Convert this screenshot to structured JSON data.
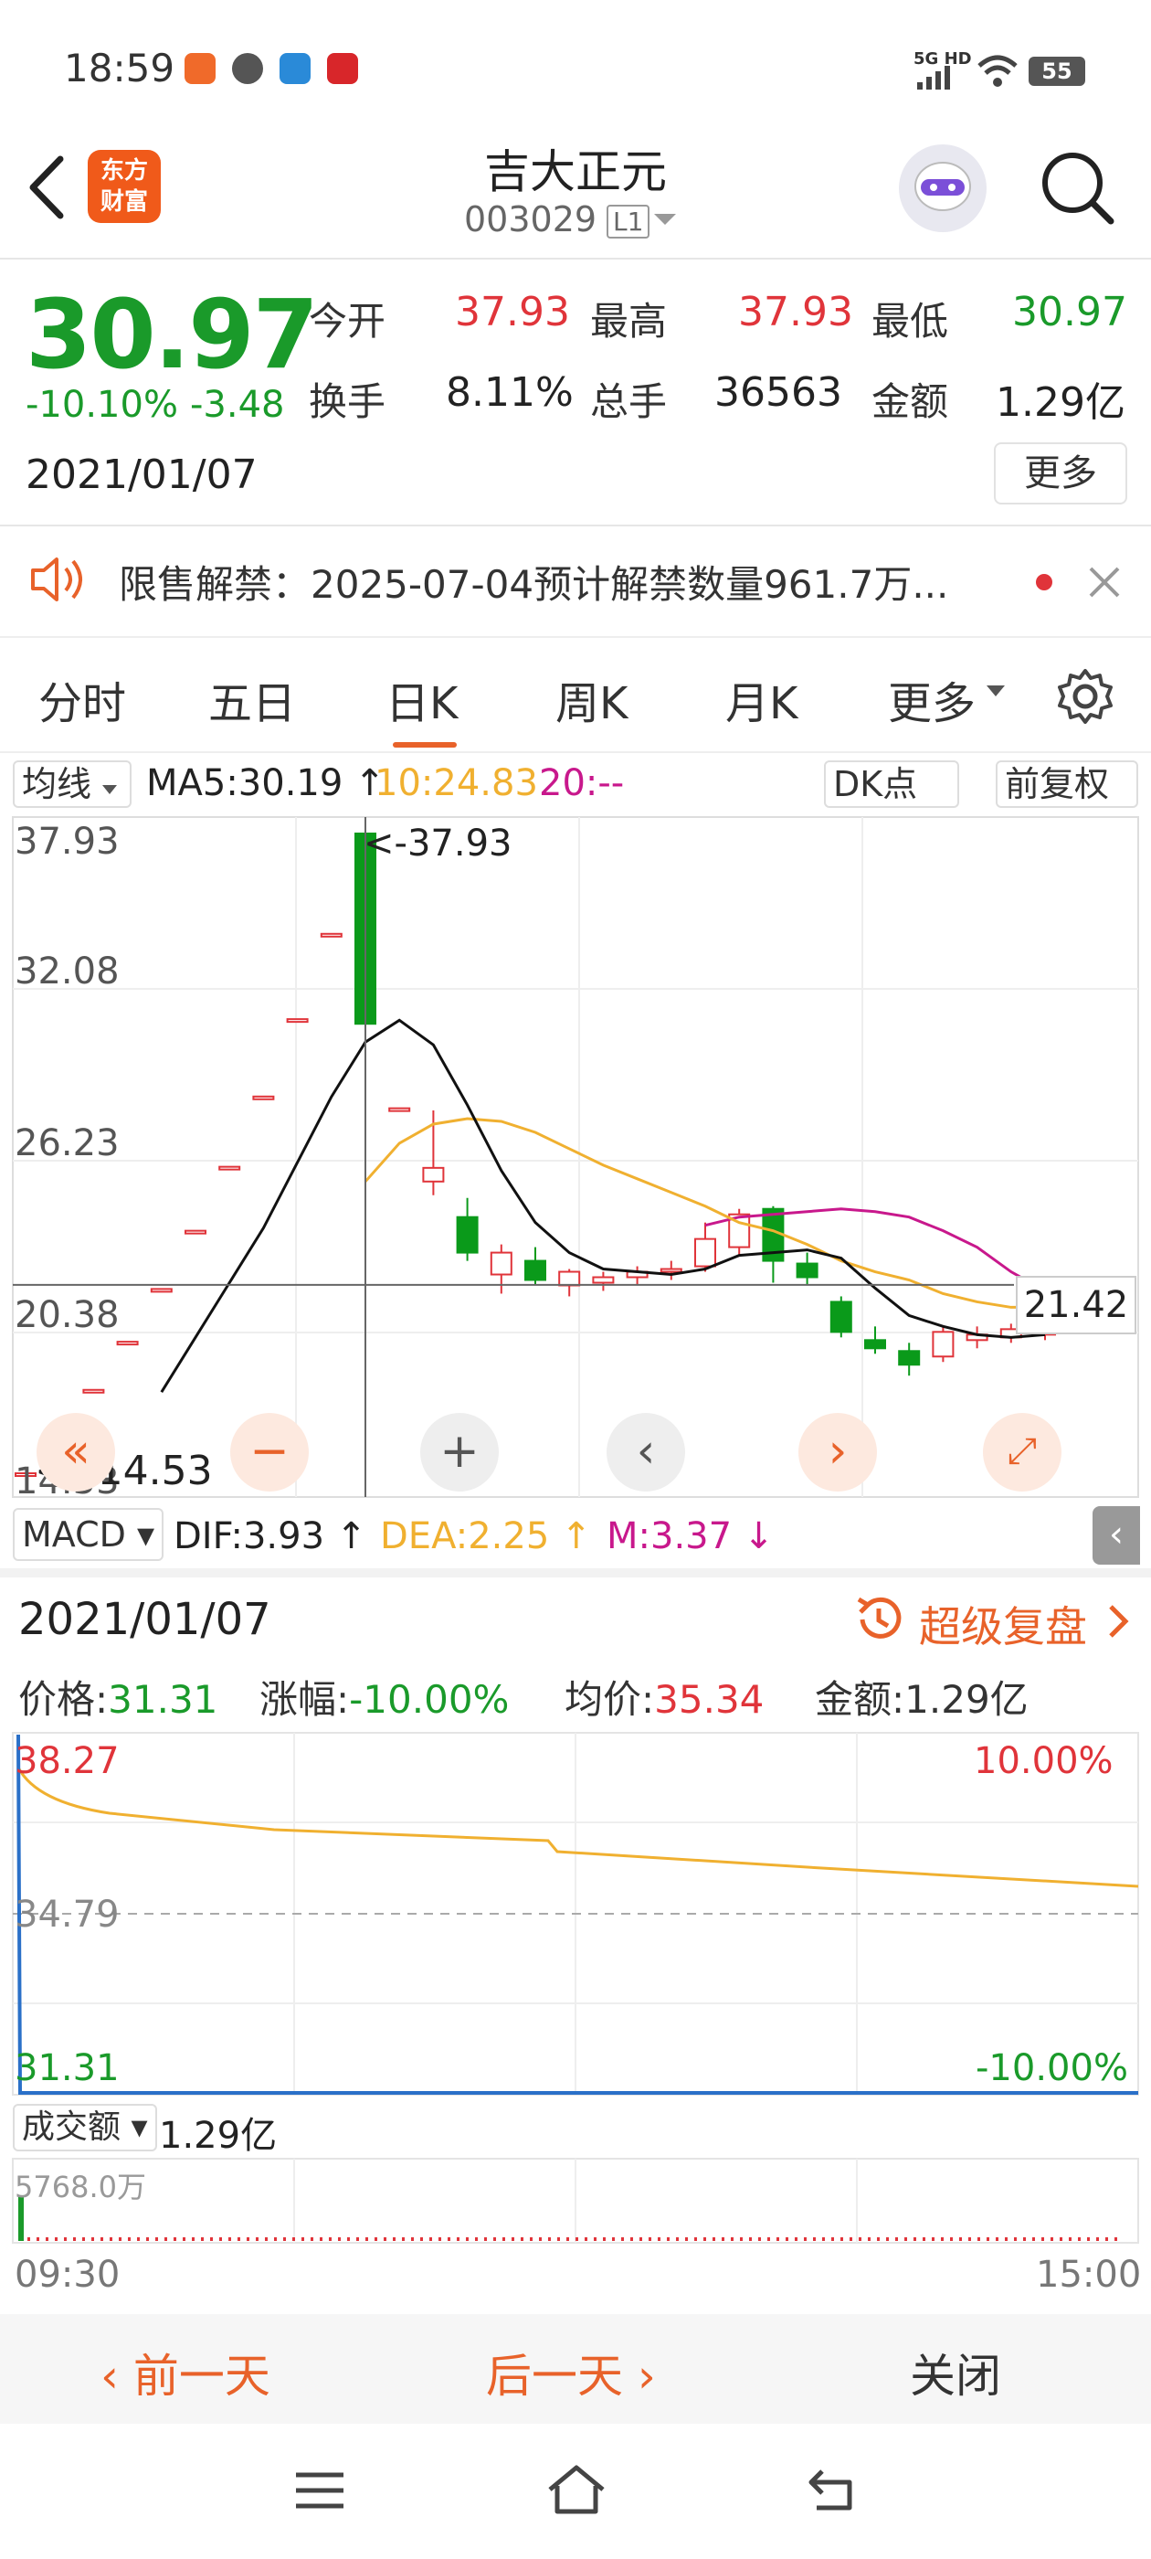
{
  "status_bar": {
    "time": "18:59",
    "network": "5G HD",
    "battery": "55"
  },
  "header": {
    "title": "吉大正元",
    "code": "003029",
    "level": "L1",
    "logo_text": [
      "东方",
      "财富"
    ]
  },
  "quote": {
    "price": "30.97",
    "change_pct": "-10.10%",
    "change": "-3.48",
    "date": "2021/01/07",
    "open_label": "今开",
    "open": "37.93",
    "high_label": "最高",
    "high": "37.93",
    "low_label": "最低",
    "low": "30.97",
    "turnover_label": "换手",
    "turnover": "8.11%",
    "volume_label": "总手",
    "volume": "36563",
    "amount_label": "金额",
    "amount": "1.29亿",
    "more_label": "更多"
  },
  "notice": {
    "text": "限售解禁：2025-07-04预计解禁数量961.7万..."
  },
  "tabs": [
    {
      "label": "分时"
    },
    {
      "label": "五日"
    },
    {
      "label": "日K"
    },
    {
      "label": "周K"
    },
    {
      "label": "月K"
    },
    {
      "label": "更多"
    }
  ],
  "kline": {
    "indicator_select": "均线",
    "ma5": "MA5:30.19",
    "ma10": "10:24.83",
    "ma20": "20:--",
    "dk_label": "DK点",
    "adjust_label": "前复权",
    "y_labels": [
      "37.93",
      "32.08",
      "26.23",
      "20.38",
      "14.53"
    ],
    "max_marker": "<-37.93",
    "min_marker": "<--14.53",
    "crosshair_value": "21.42",
    "sub_select": "MACD",
    "dif": "DIF:3.93",
    "dea": "DEA:2.25",
    "m": "M:3.37",
    "colors": {
      "up": "#e0343a",
      "down": "#0a9a1a",
      "ma5": "#111111",
      "ma10": "#f0b030",
      "ma20": "#c8188c"
    },
    "candles": [
      {
        "o": 14.53,
        "h": 14.53,
        "l": 14.53,
        "c": 14.53
      },
      {
        "o": 15.98,
        "h": 15.98,
        "l": 15.98,
        "c": 15.98
      },
      {
        "o": 17.58,
        "h": 17.58,
        "l": 17.58,
        "c": 17.58
      },
      {
        "o": 19.34,
        "h": 19.34,
        "l": 19.34,
        "c": 19.34
      },
      {
        "o": 21.27,
        "h": 21.27,
        "l": 21.27,
        "c": 21.27
      },
      {
        "o": 23.4,
        "h": 23.4,
        "l": 23.4,
        "c": 23.4
      },
      {
        "o": 25.74,
        "h": 25.74,
        "l": 25.74,
        "c": 25.74
      },
      {
        "o": 28.31,
        "h": 28.31,
        "l": 28.31,
        "c": 28.31
      },
      {
        "o": 31.14,
        "h": 31.14,
        "l": 31.14,
        "c": 31.14
      },
      {
        "o": 34.26,
        "h": 34.26,
        "l": 34.26,
        "c": 34.26
      },
      {
        "o": 37.93,
        "h": 37.93,
        "l": 30.97,
        "c": 30.97
      },
      {
        "o": 27.88,
        "h": 27.88,
        "l": 27.88,
        "c": 27.88
      },
      {
        "o": 25.2,
        "h": 27.8,
        "l": 24.7,
        "c": 25.7
      },
      {
        "o": 23.9,
        "h": 24.6,
        "l": 22.3,
        "c": 22.6
      },
      {
        "o": 21.8,
        "h": 22.9,
        "l": 21.1,
        "c": 22.6
      },
      {
        "o": 22.3,
        "h": 22.8,
        "l": 21.4,
        "c": 21.6
      },
      {
        "o": 21.4,
        "h": 22.0,
        "l": 21.0,
        "c": 21.9
      },
      {
        "o": 21.5,
        "h": 21.9,
        "l": 21.2,
        "c": 21.7
      },
      {
        "o": 21.7,
        "h": 22.1,
        "l": 21.4,
        "c": 21.9
      },
      {
        "o": 21.9,
        "h": 22.3,
        "l": 21.6,
        "c": 22.0
      },
      {
        "o": 22.1,
        "h": 23.7,
        "l": 21.9,
        "c": 23.1
      },
      {
        "o": 22.8,
        "h": 24.2,
        "l": 22.5,
        "c": 24.0
      },
      {
        "o": 24.2,
        "h": 24.3,
        "l": 21.5,
        "c": 22.3
      },
      {
        "o": 22.2,
        "h": 22.6,
        "l": 21.4,
        "c": 21.7
      },
      {
        "o": 20.8,
        "h": 21.0,
        "l": 19.5,
        "c": 19.7
      },
      {
        "o": 19.4,
        "h": 19.9,
        "l": 18.9,
        "c": 19.1
      },
      {
        "o": 19.0,
        "h": 19.3,
        "l": 18.1,
        "c": 18.5
      },
      {
        "o": 18.8,
        "h": 19.9,
        "l": 18.6,
        "c": 19.7
      },
      {
        "o": 19.4,
        "h": 19.9,
        "l": 19.1,
        "c": 19.6
      },
      {
        "o": 19.5,
        "h": 20.0,
        "l": 19.3,
        "c": 19.8
      },
      {
        "o": 19.6,
        "h": 20.0,
        "l": 19.4,
        "c": 19.9
      }
    ],
    "ma5_values": [
      null,
      null,
      null,
      null,
      17.5,
      19.5,
      21.5,
      23.5,
      25.9,
      28.3,
      30.3,
      31.1,
      30.2,
      28.0,
      25.6,
      23.7,
      22.6,
      22.0,
      21.9,
      21.8,
      22.0,
      22.5,
      22.6,
      22.7,
      22.4,
      21.3,
      20.3,
      19.9,
      19.6,
      19.5,
      19.6
    ],
    "ma10_values": [
      null,
      null,
      null,
      null,
      null,
      null,
      null,
      null,
      null,
      null,
      25.2,
      26.6,
      27.3,
      27.5,
      27.4,
      27.0,
      26.4,
      25.8,
      25.3,
      24.8,
      24.3,
      23.7,
      23.4,
      22.9,
      22.3,
      21.9,
      21.6,
      21.1,
      20.8,
      20.6,
      20.6
    ],
    "ma20_values": [
      null,
      null,
      null,
      null,
      null,
      null,
      null,
      null,
      null,
      null,
      null,
      null,
      null,
      null,
      null,
      null,
      null,
      null,
      null,
      null,
      23.6,
      23.9,
      24.0,
      24.1,
      24.2,
      24.1,
      23.9,
      23.4,
      22.8,
      21.9,
      21.2
    ]
  },
  "intraday": {
    "date": "2021/01/07",
    "replay_label": "超级复盘",
    "price_label": "价格:",
    "price": "31.31",
    "pct_label": "涨幅:",
    "pct": "-10.00%",
    "avg_label": "均价:",
    "avg": "35.34",
    "amount_label": "金额:",
    "amount": "1.29亿",
    "y_top": "38.27",
    "y_mid": "34.79",
    "y_bot": "31.31",
    "pct_top": "10.00%",
    "pct_bot": "-10.00%",
    "vol_select": "成交额",
    "vol_total": "1.29亿",
    "vol_max": "5768.0万",
    "t_start": "09:30",
    "t_end": "15:00"
  },
  "footer": {
    "prev": "前一天",
    "next": "后一天",
    "close": "关闭"
  }
}
